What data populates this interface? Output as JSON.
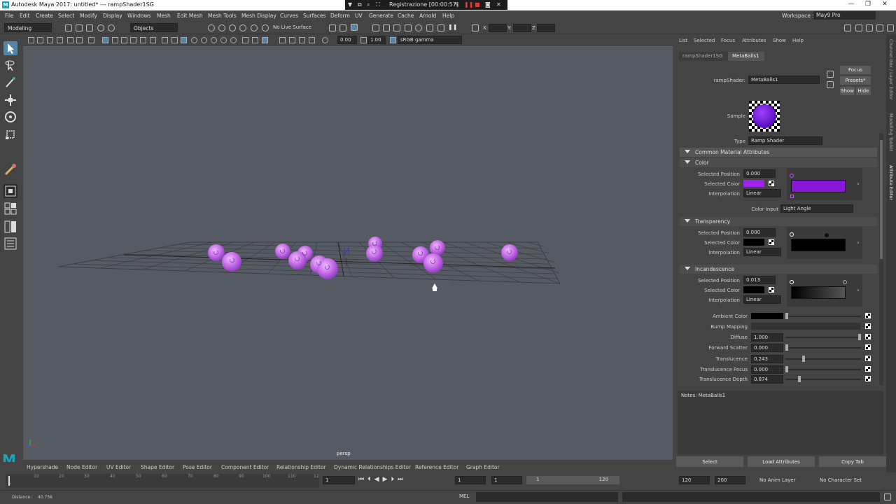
{
  "window": {
    "title": "Autodesk Maya 2017: untitled*   ---   rampShader1SG"
  },
  "recorder": {
    "label": "Registrazione [00:00:57]"
  },
  "menu": [
    "File",
    "Edit",
    "Create",
    "Select",
    "Modify",
    "Display",
    "Windows",
    "Mesh",
    "Edit Mesh",
    "Mesh Tools",
    "Mesh Display",
    "Curves",
    "Surfaces",
    "Deform",
    "UV",
    "Generate",
    "Cache",
    "Arnold",
    "Help"
  ],
  "workspace": {
    "label": "Workspace :",
    "value": "May9 Pro"
  },
  "shelf": {
    "mode": "Modeling",
    "objects": "Objects",
    "live": "No Live Surface",
    "x": "X:",
    "y": "Y:",
    "z": "Z:"
  },
  "viewport_toolbar": {
    "exposure": "0.00",
    "gamma": "1.00",
    "colorspace": "sRGB gamma"
  },
  "viewport": {
    "camera": "persp"
  },
  "bottom_tabs": [
    "Hypershade",
    "Node Editor",
    "UV Editor",
    "Shape Editor",
    "Pose Editor",
    "Component Editor",
    "Relationship Editor",
    "Dynamic Relationships Editor",
    "Reference Editor",
    "Graph Editor"
  ],
  "timeline": {
    "ticks": [
      "1",
      "10",
      "20",
      "30",
      "40",
      "50",
      "60",
      "70",
      "80",
      "90",
      "100",
      "110",
      "12"
    ],
    "current": "1",
    "start": "1",
    "start2": "1",
    "range_start": "1",
    "range_end": "120",
    "end": "120",
    "end2": "200",
    "anim_layer": "No Anim Layer",
    "char_set": "No Character Set"
  },
  "cmdline": {
    "mel": "MEL",
    "distance_label": "Distance:",
    "distance": "40.756"
  },
  "ae": {
    "menu": [
      "List",
      "Selected",
      "Focus",
      "Attributes",
      "Show",
      "Help"
    ],
    "tabs": [
      "rampShader1SG",
      "MetaBalls1"
    ],
    "shader_label": "rampShader:",
    "shader_name": "MetaBalls1",
    "focus": "Focus",
    "presets": "Presets*",
    "show": "Show",
    "hide": "Hide",
    "sample": "Sample",
    "type_label": "Type",
    "type_value": "Ramp Shader",
    "common": "Common Material Attributes",
    "color": {
      "title": "Color",
      "pos_label": "Selected Position",
      "pos": "0.000",
      "col_label": "Selected Color",
      "interp_label": "Interpolation",
      "interp": "Linear",
      "input_label": "Color Input",
      "input": "Light Angle"
    },
    "transparency": {
      "title": "Transparency",
      "pos_label": "Selected Position",
      "pos": "0.000",
      "col_label": "Selected Color",
      "interp_label": "Interpolation",
      "interp": "Linear"
    },
    "incandescence": {
      "title": "Incandescence",
      "pos_label": "Selected Position",
      "pos": "0.013",
      "col_label": "Selected Color",
      "interp_label": "Interpolation",
      "interp": "Linear"
    },
    "ambient": "Ambient Color",
    "bump": "Bump Mapping",
    "diffuse_label": "Diffuse",
    "diffuse": "1.000",
    "fscatter_label": "Forward Scatter",
    "fscatter": "0.000",
    "transl_label": "Translucence",
    "transl": "0.243",
    "tfocus_label": "Translucence Focus",
    "tfocus": "0.000",
    "tdepth_label": "Translucence Depth",
    "tdepth": "0.874",
    "notes": "Notes:  MetaBalls1",
    "select": "Select",
    "load": "Load Attributes",
    "copy": "Copy Tab"
  },
  "sidetabs": [
    "Channel Box / Layer Editor",
    "Modelling Toolkit",
    "Attribute Editor"
  ],
  "colors": {
    "accent": "#8a16d8",
    "sphere": "#c86ee8",
    "bg": "#444444",
    "viewport": "#565a62"
  }
}
